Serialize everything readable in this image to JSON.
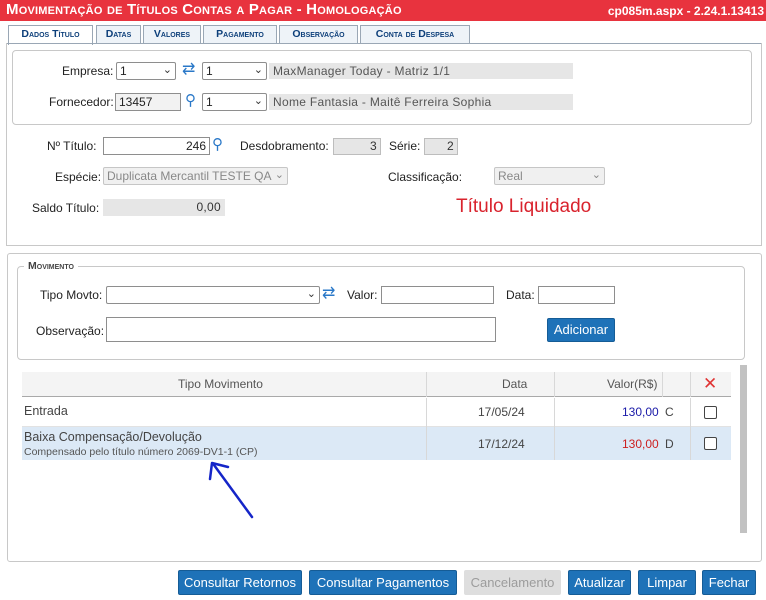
{
  "window": {
    "title": "Movimentação de Títulos Contas a Pagar  - Homologação",
    "page_info": "cp085m.aspx - 2.24.1.13413"
  },
  "tabs": [
    {
      "label": "Dados Título",
      "active": true
    },
    {
      "label": "Datas"
    },
    {
      "label": "Valores"
    },
    {
      "label": "Pagamento"
    },
    {
      "label": "Observação"
    },
    {
      "label": "Conta de Despesa"
    }
  ],
  "empresa": {
    "label": "Empresa:",
    "code": "1",
    "branch": "1",
    "name": "MaxManager Today - Matriz 1/1"
  },
  "fornecedor": {
    "label": "Fornecedor:",
    "code": "13457",
    "branch": "1",
    "name": "Nome Fantasia - Maitê Ferreira Sophia"
  },
  "titulo": {
    "numero_label": "Nº Título:",
    "numero": "246",
    "desdobramento_label": "Desdobramento:",
    "desdobramento": "3",
    "serie_label": "Série:",
    "serie": "2",
    "especie_label": "Espécie:",
    "especie": "Duplicata Mercantil TESTE QA",
    "classificacao_label": "Classificação:",
    "classificacao": "Real",
    "saldo_label": "Saldo Título:",
    "saldo": "0,00",
    "status": "Título Liquidado"
  },
  "movimento": {
    "legend": "Movimento",
    "tipo_label": "Tipo Movto:",
    "tipo_value": "",
    "valor_label": "Valor:",
    "valor_value": "",
    "data_label": "Data:",
    "data_value": "",
    "obs_label": "Observação:",
    "obs_value": "",
    "add_button": "Adicionar"
  },
  "grid": {
    "headers": {
      "tipo": "Tipo Movimento",
      "data": "Data",
      "valor": "Valor(R$)",
      "delete_icon": "close-icon"
    },
    "rows": [
      {
        "tipo": "Entrada",
        "sub": "",
        "data": "17/05/24",
        "valor": "130,00",
        "dc": "C",
        "color": "#1a1aa8"
      },
      {
        "tipo": "Baixa Compensação/Devolução",
        "sub": "Compensado pelo título número 2069-DV1-1 (CP)",
        "data": "17/12/24",
        "valor": "130,00",
        "dc": "D",
        "color": "#cc1f1f",
        "highlight": "#dce9f6"
      }
    ]
  },
  "buttons": {
    "consultar_retornos": "Consultar Retornos",
    "consultar_pagamentos": "Consultar Pagamentos",
    "cancelamento": "Cancelamento",
    "atualizar": "Atualizar",
    "limpar": "Limpar",
    "fechar": "Fechar"
  },
  "colors": {
    "title_bar": "#e8333e",
    "primary_button": "#1e72b8",
    "status_red": "#d9232d",
    "annotation_arrow": "#1525c8"
  }
}
